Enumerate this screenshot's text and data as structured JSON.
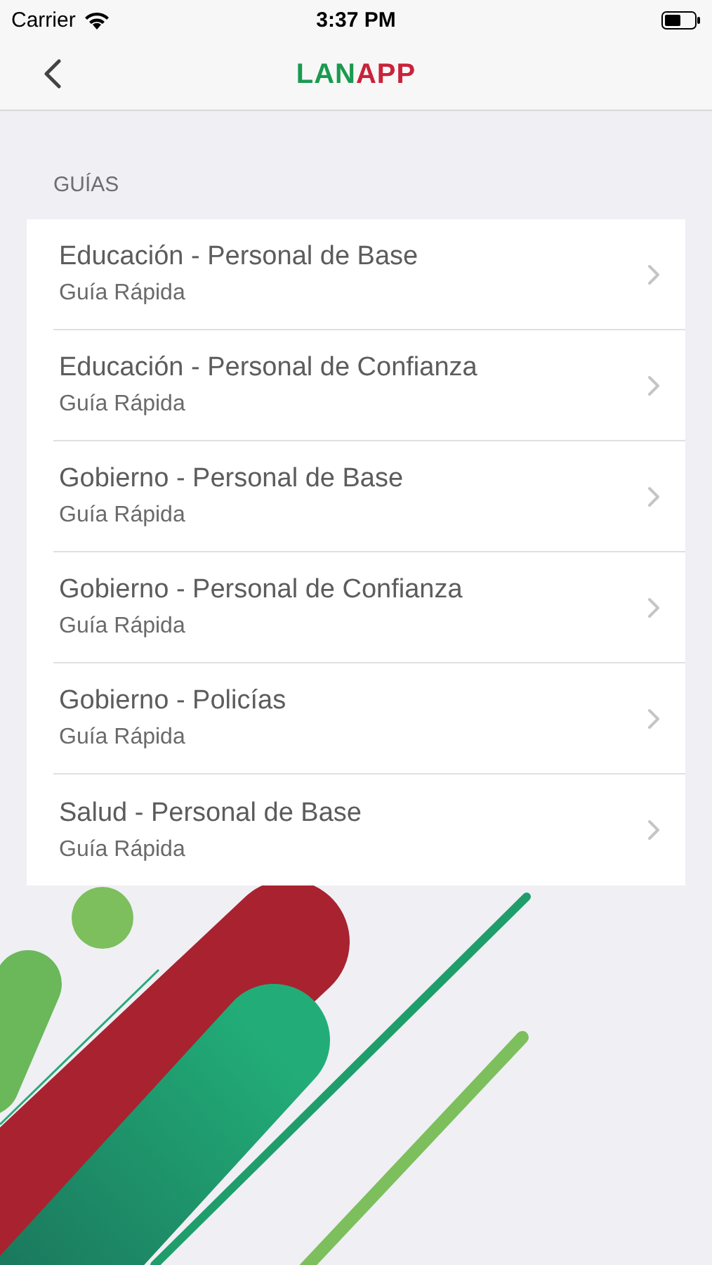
{
  "status_bar": {
    "carrier": "Carrier",
    "time": "3:37 PM"
  },
  "nav_bar": {
    "title_parts": [
      {
        "text": "LAN",
        "color": "#1a9a4f"
      },
      {
        "text": "APP",
        "color": "#c8233a"
      }
    ]
  },
  "section": {
    "header": "GUÍAS",
    "items": [
      {
        "title": "Educación - Personal de Base",
        "subtitle": "Guía Rápida"
      },
      {
        "title": "Educación - Personal de Confianza",
        "subtitle": "Guía Rápida"
      },
      {
        "title": "Gobierno - Personal de Base",
        "subtitle": "Guía Rápida"
      },
      {
        "title": "Gobierno - Personal de Confianza",
        "subtitle": "Guía Rápida"
      },
      {
        "title": "Gobierno - Policías",
        "subtitle": "Guía Rápida"
      },
      {
        "title": "Salud - Personal de Base",
        "subtitle": "Guía Rápida"
      }
    ]
  }
}
